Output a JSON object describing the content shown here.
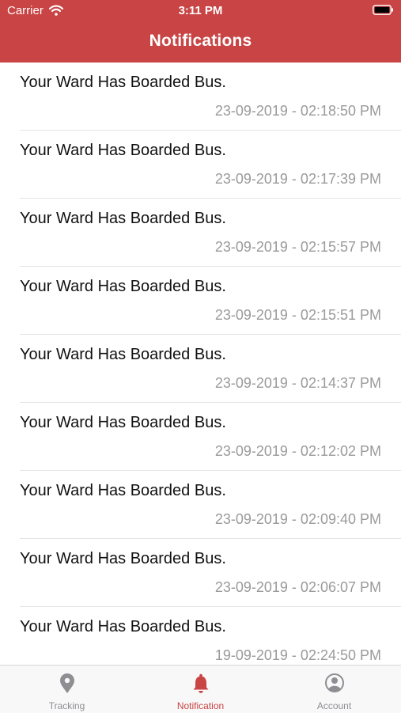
{
  "status_bar": {
    "carrier": "Carrier",
    "time": "3:11 PM"
  },
  "header": {
    "title": "Notifications"
  },
  "notifications": [
    {
      "message": "Your Ward Has Boarded Bus.",
      "timestamp": "23-09-2019 - 02:18:50 PM"
    },
    {
      "message": "Your Ward Has Boarded Bus.",
      "timestamp": "23-09-2019 - 02:17:39 PM"
    },
    {
      "message": "Your Ward Has Boarded Bus.",
      "timestamp": "23-09-2019 - 02:15:57 PM"
    },
    {
      "message": "Your Ward Has Boarded Bus.",
      "timestamp": "23-09-2019 - 02:15:51 PM"
    },
    {
      "message": "Your Ward Has Boarded Bus.",
      "timestamp": "23-09-2019 - 02:14:37 PM"
    },
    {
      "message": "Your Ward Has Boarded Bus.",
      "timestamp": "23-09-2019 - 02:12:02 PM"
    },
    {
      "message": "Your Ward Has Boarded Bus.",
      "timestamp": "23-09-2019 - 02:09:40 PM"
    },
    {
      "message": "Your Ward Has Boarded Bus.",
      "timestamp": "23-09-2019 - 02:06:07 PM"
    },
    {
      "message": "Your Ward Has Boarded Bus.",
      "timestamp": "19-09-2019 - 02:24:50 PM"
    }
  ],
  "tabbar": {
    "tabs": [
      {
        "label": "Tracking",
        "icon": "location-pin-icon",
        "active": false
      },
      {
        "label": "Notification",
        "icon": "bell-icon",
        "active": true
      },
      {
        "label": "Account",
        "icon": "account-icon",
        "active": false
      }
    ]
  },
  "colors": {
    "accent": "#c94444",
    "inactive_tab": "#8e8e93",
    "timestamp": "#9a9a9a"
  }
}
